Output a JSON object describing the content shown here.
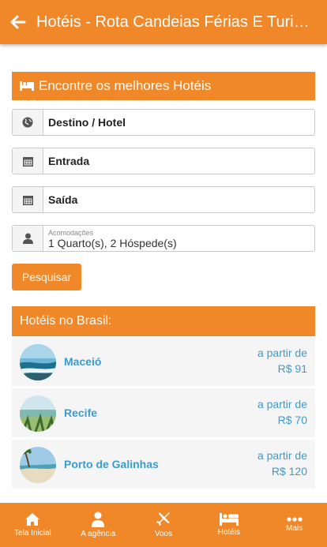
{
  "header": {
    "title": "Hotéis - Rota Candeias Férias E Turismo"
  },
  "search": {
    "banner": "Encontre os melhores Hotéis",
    "destination": "Destino / Hotel",
    "checkin": "Entrada",
    "checkout": "Saída",
    "rooms_label": "Acomodações",
    "rooms_value": "1 Quarto(s), 2 Hóspede(s)",
    "button": "Pesquisar"
  },
  "hotels": {
    "title": "Hotéis no Brasil:",
    "items": [
      {
        "name": "Maceió",
        "from": "a partir de",
        "price": "R$ 91"
      },
      {
        "name": "Recife",
        "from": "a partir de",
        "price": "R$ 70"
      },
      {
        "name": "Porto de Galinhas",
        "from": "a partir de",
        "price": "R$ 120"
      }
    ]
  },
  "tabs": [
    {
      "label": "Tela Inicial",
      "icon": "home-icon"
    },
    {
      "label": "A agência",
      "icon": "user-icon"
    },
    {
      "label": "Voos",
      "icon": "plane-icon"
    },
    {
      "label": "Hotéis",
      "icon": "bed-icon"
    },
    {
      "label": "Mais",
      "icon": "more-icon"
    }
  ],
  "colors": {
    "accent": "#f0882a",
    "link": "#3b9bcf"
  }
}
